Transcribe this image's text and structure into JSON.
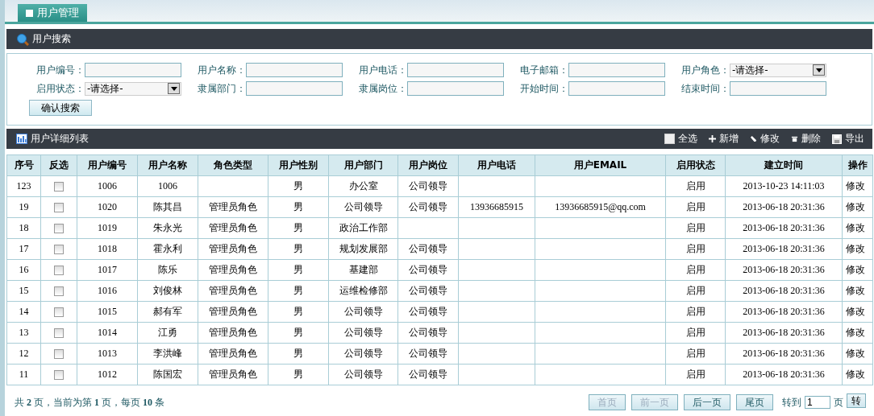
{
  "tabs": [
    {
      "label": "用户管理",
      "selected": true
    }
  ],
  "search_panel": {
    "title": "用户搜索",
    "fields": [
      {
        "label": "用户编号：",
        "kind": "text"
      },
      {
        "label": "用户名称：",
        "kind": "text"
      },
      {
        "label": "用户电话：",
        "kind": "text"
      },
      {
        "label": "电子邮箱：",
        "kind": "text"
      },
      {
        "label": "用户角色：",
        "kind": "select",
        "value": "-请选择-"
      },
      {
        "label": "启用状态：",
        "kind": "select",
        "value": "-请选择-"
      },
      {
        "label": "隶属部门：",
        "kind": "text"
      },
      {
        "label": "隶属岗位：",
        "kind": "text"
      },
      {
        "label": "开始时间：",
        "kind": "text"
      },
      {
        "label": "结束时间：",
        "kind": "text"
      }
    ],
    "submit_button": "确认搜索"
  },
  "list_panel": {
    "title": "用户详细列表",
    "select_all": {
      "label": "全选",
      "checked": false
    },
    "toolbar": [
      {
        "label": "新增",
        "kind": "add"
      },
      {
        "label": "修改",
        "kind": "edit"
      },
      {
        "label": "删除",
        "kind": "delete"
      },
      {
        "label": "导出",
        "kind": "export"
      }
    ]
  },
  "table": {
    "columns": [
      "序号",
      "反选",
      "用户编号",
      "用户名称",
      "角色类型",
      "用户性别",
      "用户部门",
      "用户岗位",
      "用户电话",
      "用户EMAIL",
      "启用状态",
      "建立时间",
      "操作"
    ],
    "rows": [
      {
        "index": "123",
        "checked": false,
        "id": "1006",
        "name": "1006",
        "role": "",
        "gender": "男",
        "department": "办公室",
        "position": "公司领导",
        "phone": "",
        "email": "",
        "status": "启用",
        "created": "2013-10-23 14:11:03",
        "action": "修改"
      },
      {
        "index": "19",
        "checked": false,
        "id": "1020",
        "name": "陈其昌",
        "role": "管理员角色",
        "gender": "男",
        "department": "公司领导",
        "position": "公司领导",
        "phone": "13936685915",
        "email": "13936685915@qq.com",
        "status": "启用",
        "created": "2013-06-18 20:31:36",
        "action": "修改"
      },
      {
        "index": "18",
        "checked": false,
        "id": "1019",
        "name": "朱永光",
        "role": "管理员角色",
        "gender": "男",
        "department": "政治工作部",
        "position": "",
        "phone": "",
        "email": "",
        "status": "启用",
        "created": "2013-06-18 20:31:36",
        "action": "修改"
      },
      {
        "index": "17",
        "checked": false,
        "id": "1018",
        "name": "霍永利",
        "role": "管理员角色",
        "gender": "男",
        "department": "规划发展部",
        "position": "公司领导",
        "phone": "",
        "email": "",
        "status": "启用",
        "created": "2013-06-18 20:31:36",
        "action": "修改"
      },
      {
        "index": "16",
        "checked": false,
        "id": "1017",
        "name": "陈乐",
        "role": "管理员角色",
        "gender": "男",
        "department": "基建部",
        "position": "公司领导",
        "phone": "",
        "email": "",
        "status": "启用",
        "created": "2013-06-18 20:31:36",
        "action": "修改"
      },
      {
        "index": "15",
        "checked": false,
        "id": "1016",
        "name": "刘俊林",
        "role": "管理员角色",
        "gender": "男",
        "department": "运维检修部",
        "position": "公司领导",
        "phone": "",
        "email": "",
        "status": "启用",
        "created": "2013-06-18 20:31:36",
        "action": "修改"
      },
      {
        "index": "14",
        "checked": false,
        "id": "1015",
        "name": "郝有军",
        "role": "管理员角色",
        "gender": "男",
        "department": "公司领导",
        "position": "公司领导",
        "phone": "",
        "email": "",
        "status": "启用",
        "created": "2013-06-18 20:31:36",
        "action": "修改"
      },
      {
        "index": "13",
        "checked": false,
        "id": "1014",
        "name": "江勇",
        "role": "管理员角色",
        "gender": "男",
        "department": "公司领导",
        "position": "公司领导",
        "phone": "",
        "email": "",
        "status": "启用",
        "created": "2013-06-18 20:31:36",
        "action": "修改"
      },
      {
        "index": "12",
        "checked": false,
        "id": "1013",
        "name": "李洪峰",
        "role": "管理员角色",
        "gender": "男",
        "department": "公司领导",
        "position": "公司领导",
        "phone": "",
        "email": "",
        "status": "启用",
        "created": "2013-06-18 20:31:36",
        "action": "修改"
      },
      {
        "index": "11",
        "checked": false,
        "id": "1012",
        "name": "陈国宏",
        "role": "管理员角色",
        "gender": "男",
        "department": "公司领导",
        "position": "公司领导",
        "phone": "",
        "email": "",
        "status": "启用",
        "created": "2013-06-18 20:31:36",
        "action": "修改"
      }
    ]
  },
  "pagination": {
    "summary": "共 **2** 页，当前为第 **1** 页，每页 **10** 条",
    "buttons": [
      {
        "label": "首页",
        "disabled": true
      },
      {
        "label": "前一页",
        "disabled": true
      },
      {
        "label": "后一页",
        "disabled": false
      },
      {
        "label": "尾页",
        "disabled": false
      }
    ],
    "goto_label": "转到",
    "goto_value": "1",
    "page_unit": "页",
    "go_button": "转"
  }
}
